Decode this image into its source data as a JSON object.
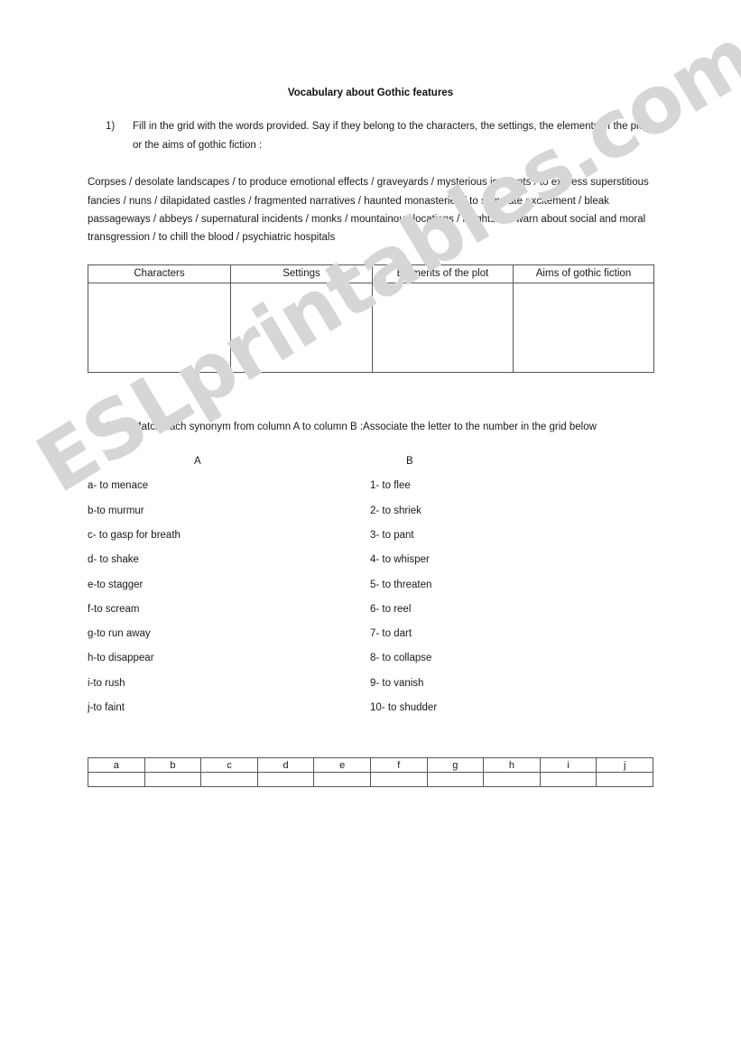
{
  "document": {
    "title": "Vocabulary about Gothic features",
    "watermark": "ESLprintables.com"
  },
  "exercise1": {
    "number": "1)",
    "instruction": "Fill in the grid with the words provided. Say if they belong to the characters, the settings, the elements of the plot or the aims of gothic fiction :",
    "word_bank": "Corpses / desolate landscapes / to produce emotional effects / graveyards / mysterious incidents / to express superstitious fancies / nuns / dilapidated castles / fragmented narratives / haunted monasteries / to stimulate excitement / bleak passageways / abbeys / supernatural incidents / monks / mountainous locations / knights / to warn about social and moral transgression / to chill the blood / psychiatric hospitals",
    "table": {
      "headers": [
        "Characters",
        "Settings",
        "Elements of the plot",
        "Aims of gothic fiction"
      ],
      "rows": [
        [
          "",
          "",
          "",
          ""
        ]
      ]
    }
  },
  "exercise2": {
    "number": "2)",
    "instruction": "Match each synonym from column A to column B :Associate the letter to the number in the grid below",
    "column_a_header": "A",
    "column_b_header": "B",
    "column_a": [
      "a- to menace",
      "b-to murmur",
      "c- to gasp for breath",
      "d- to shake",
      "e-to stagger",
      "f-to scream",
      "g-to run away",
      "h-to disappear",
      "i-to rush",
      "j-to faint"
    ],
    "column_b": [
      "1- to flee",
      "2- to shriek",
      "3- to pant",
      "4- to whisper",
      "5- to threaten",
      "6- to reel",
      "7- to dart",
      "8- to collapse",
      "9- to vanish",
      "10- to shudder"
    ],
    "answer_grid": {
      "letters": [
        "a",
        "b",
        "c",
        "d",
        "e",
        "f",
        "g",
        "h",
        "i",
        "j"
      ],
      "answers": [
        "",
        "",
        "",
        "",
        "",
        "",
        "",
        "",
        "",
        ""
      ]
    }
  }
}
